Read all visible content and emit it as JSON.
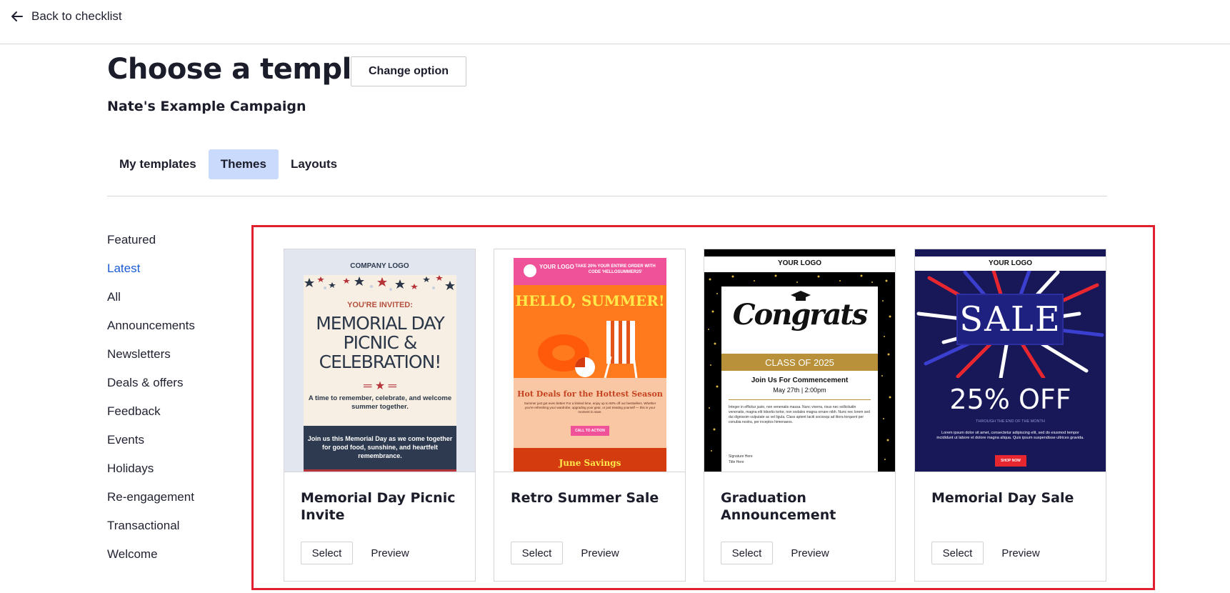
{
  "nav": {
    "back_label": "Back to checklist"
  },
  "header": {
    "title": "Choose a template",
    "change_option_label": "Change option",
    "campaign_name": "Nate's Example Campaign"
  },
  "tabs": [
    {
      "label": "My templates",
      "active": false
    },
    {
      "label": "Themes",
      "active": true
    },
    {
      "label": "Layouts",
      "active": false
    }
  ],
  "categories": [
    {
      "label": "Featured",
      "active": false
    },
    {
      "label": "Latest",
      "active": true
    },
    {
      "label": "All",
      "active": false
    },
    {
      "label": "Announcements",
      "active": false
    },
    {
      "label": "Newsletters",
      "active": false
    },
    {
      "label": "Deals & offers",
      "active": false
    },
    {
      "label": "Feedback",
      "active": false
    },
    {
      "label": "Events",
      "active": false
    },
    {
      "label": "Holidays",
      "active": false
    },
    {
      "label": "Re-engagement",
      "active": false
    },
    {
      "label": "Transactional",
      "active": false
    },
    {
      "label": "Welcome",
      "active": false
    }
  ],
  "templates": [
    {
      "title": "Memorial Day Picnic Invite",
      "select_label": "Select",
      "preview_label": "Preview",
      "thumb": {
        "logo": "COMPANY LOGO",
        "invited": "YOU'RE INVITED:",
        "headline": "MEMORIAL DAY PICNIC & CELEBRATION!",
        "sub": "A time to remember, celebrate, and welcome summer together.",
        "dark_text": "Join us this Memorial Day as we come together for good food, sunshine, and heartfelt remembrance."
      }
    },
    {
      "title": "Retro Summer Sale",
      "select_label": "Select",
      "preview_label": "Preview",
      "thumb": {
        "logo": "YOUR LOGO",
        "promo": "TAKE 20% YOUR ENTIRE ORDER WITH CODE 'HELLOSUMMER25'",
        "hello": "HELLO, SUMMER!",
        "hot": "Hot Deals for the Hottest Season",
        "cta": "CALL TO ACTION",
        "june": "June Savings"
      }
    },
    {
      "title": "Graduation Announcement",
      "select_label": "Select",
      "preview_label": "Preview",
      "thumb": {
        "logo": "YOUR LOGO",
        "congrats": "Congrats",
        "class_of": "CLASS OF 2025",
        "join": "Join Us For Commencement",
        "date": "May 27th | 2:00pm",
        "signature": "Signature Here",
        "title_here": "Title Here"
      }
    },
    {
      "title": "Memorial Day Sale",
      "select_label": "Select",
      "preview_label": "Preview",
      "thumb": {
        "logo": "YOUR LOGO",
        "sale": "SALE",
        "off": "25% OFF",
        "through": "THROUGH THE END OF THE MONTH",
        "cta": "SHOP NOW"
      }
    }
  ],
  "colors": {
    "accent_tab": "#c9dafc",
    "active_category": "#1a5bd6",
    "highlight_border": "#e0202f"
  }
}
